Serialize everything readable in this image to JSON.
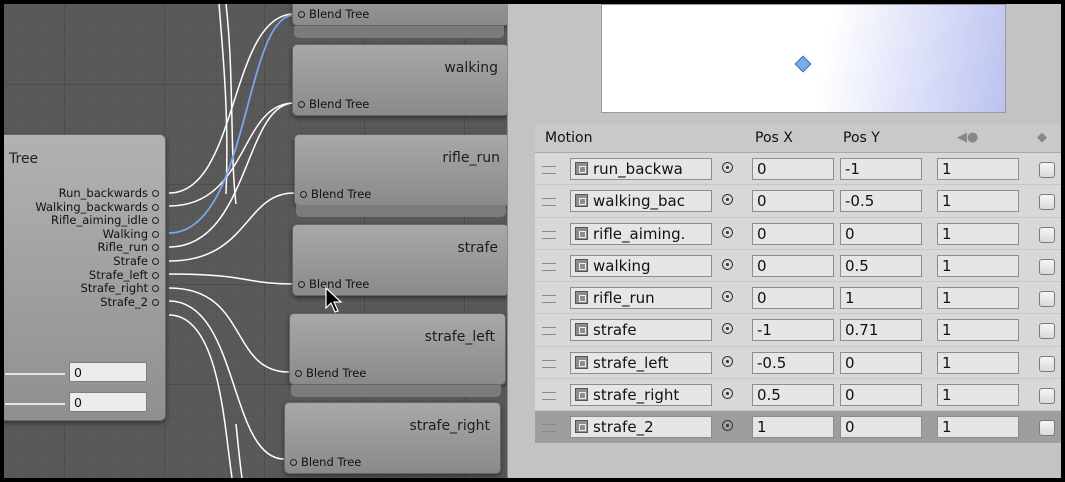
{
  "graph": {
    "tree_node": {
      "title": "Tree",
      "outputs": [
        "Run_backwards",
        "Walking_backwards",
        "Rifle_aiming_idle",
        "Walking",
        "Rifle_run",
        "Strafe",
        "Strafe_left",
        "Strafe_right",
        "Strafe_2"
      ],
      "params": [
        "0",
        "0"
      ]
    },
    "child_nodes": [
      {
        "name": "",
        "input": "Blend Tree"
      },
      {
        "name": "walking",
        "input": "Blend Tree"
      },
      {
        "name": "rifle_run",
        "input": "Blend Tree"
      },
      {
        "name": "strafe",
        "input": "Blend Tree"
      },
      {
        "name": "strafe_left",
        "input": "Blend Tree"
      },
      {
        "name": "strafe_right",
        "input": "Blend Tree"
      }
    ]
  },
  "inspector": {
    "headers": {
      "motion": "Motion",
      "pos_x": "Pos X",
      "pos_y": "Pos Y"
    },
    "rows": [
      {
        "motion": "run_backwa",
        "x": "0",
        "y": "-1",
        "speed": "1"
      },
      {
        "motion": "walking_bac",
        "x": "0",
        "y": "-0.5",
        "speed": "1"
      },
      {
        "motion": "rifle_aiming.",
        "x": "0",
        "y": "0",
        "speed": "1"
      },
      {
        "motion": "walking",
        "x": "0",
        "y": "0.5",
        "speed": "1"
      },
      {
        "motion": "rifle_run",
        "x": "0",
        "y": "1",
        "speed": "1"
      },
      {
        "motion": "strafe",
        "x": "-1",
        "y": "0.71",
        "speed": "1"
      },
      {
        "motion": "strafe_left",
        "x": "-0.5",
        "y": "0",
        "speed": "1"
      },
      {
        "motion": "strafe_right",
        "x": "0.5",
        "y": "0",
        "speed": "1"
      },
      {
        "motion": "strafe_2",
        "x": "1",
        "y": "0",
        "speed": "1"
      }
    ]
  },
  "icons": {
    "speed_header": "speed-dial-icon",
    "mirror_header": "mirror-icon",
    "row_drag": "drag-handle-icon",
    "clip": "animation-clip-icon",
    "picker": "object-picker-icon",
    "cursor": "mouse-pointer-icon"
  },
  "colors": {
    "selected_wire": "#7aa6e6",
    "wire": "#ffffff",
    "preview_point": "#7fa8ea"
  }
}
